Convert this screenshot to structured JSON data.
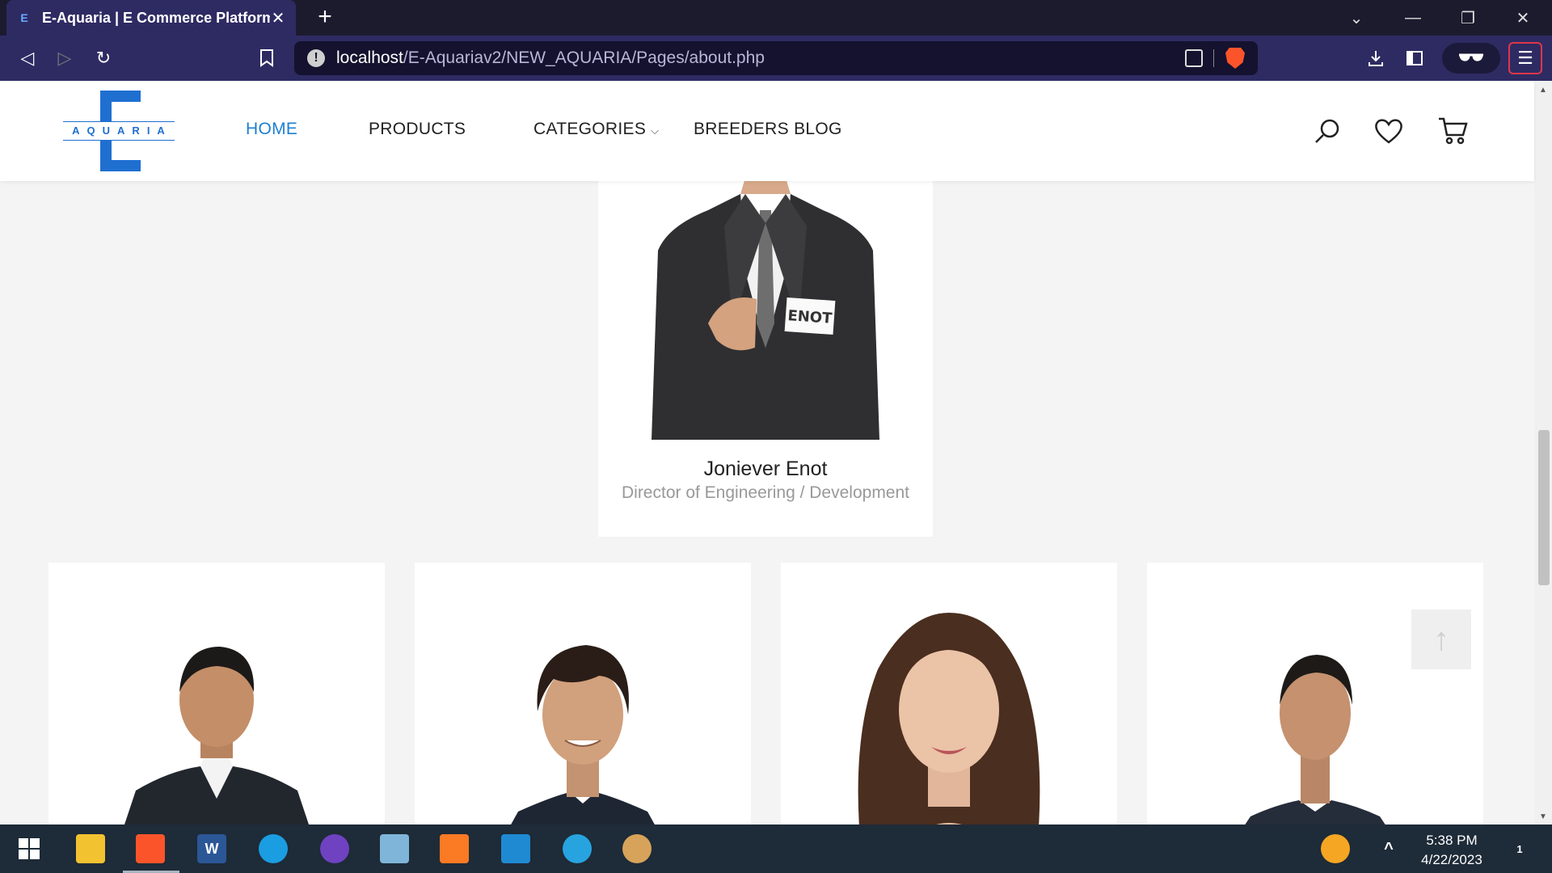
{
  "browser": {
    "tab_title": "E-Aquaria | E Commerce Platform",
    "tab_close": "✕",
    "new_tab": "+",
    "url_host": "localhost",
    "url_path": "/E-Aquariav2/NEW_AQUARIA/Pages/about.php",
    "info_icon": "!",
    "controls": {
      "chevron": "⌄",
      "minimize": "—",
      "restore": "❐",
      "close": "✕"
    },
    "toolbar": {
      "back": "◁",
      "forward": "▷",
      "reload": "↻",
      "bookmark": "🔖",
      "download": "⤓",
      "sidebar": "▣",
      "glasses": "👓",
      "menu": "☰"
    }
  },
  "site": {
    "logo_text": "AQUARIA",
    "nav": {
      "home": "HOME",
      "products": "PRODUCTS",
      "categories": "CATEGORIES",
      "categories_chevron": "⌵",
      "blog": "BREEDERS BLOG"
    }
  },
  "team": {
    "featured": {
      "name": "Joniever Enot",
      "role": "Director of Engineering / Development",
      "badge": "ENOT"
    },
    "members": [
      {
        "photo": "male-dark-suit"
      },
      {
        "photo": "male-young-smiling"
      },
      {
        "photo": "female-long-hair"
      },
      {
        "photo": "male-short-hair"
      }
    ]
  },
  "back_to_top": "↑",
  "taskbar": {
    "apps": [
      "windows-start",
      "file-explorer",
      "brave",
      "word",
      "edge",
      "github-desktop",
      "notepad",
      "xampp",
      "vscode",
      "edge-dev",
      "paint"
    ],
    "word_label": "W",
    "time": "5:38 PM",
    "date": "4/22/2023",
    "notif_count": "1"
  },
  "colors": {
    "accent": "#1e7fd0",
    "chrome": "#2e2b63",
    "brave": "#fb542b"
  }
}
